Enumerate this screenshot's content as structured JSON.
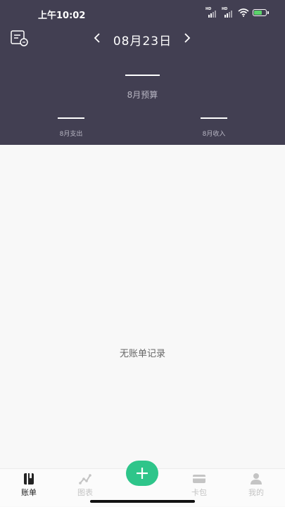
{
  "status_bar": {
    "time": "上午10:02",
    "signal_badges": [
      "HD",
      "HD"
    ],
    "icons": [
      "signal-icon",
      "signal-icon",
      "wifi-icon",
      "battery-icon"
    ]
  },
  "header": {
    "calendar_icon": "calendar-settings-icon",
    "date": "08月23日",
    "prev_icon": "chevron-left-icon",
    "next_icon": "chevron-right-icon",
    "budget_label": "8月预算",
    "expense_label": "8月支出",
    "income_label": "8月收入",
    "background_color": "#423f52"
  },
  "content": {
    "empty_message": "无账单记录"
  },
  "tabbar": {
    "tabs": [
      {
        "label": "账单",
        "icon": "book-icon",
        "active": true
      },
      {
        "label": "图表",
        "icon": "line-chart-icon",
        "active": false
      },
      {
        "label": "卡包",
        "icon": "card-icon",
        "active": false
      },
      {
        "label": "我的",
        "icon": "user-icon",
        "active": false
      }
    ],
    "add_icon": "plus-icon",
    "accent_color": "#2ec58a"
  }
}
